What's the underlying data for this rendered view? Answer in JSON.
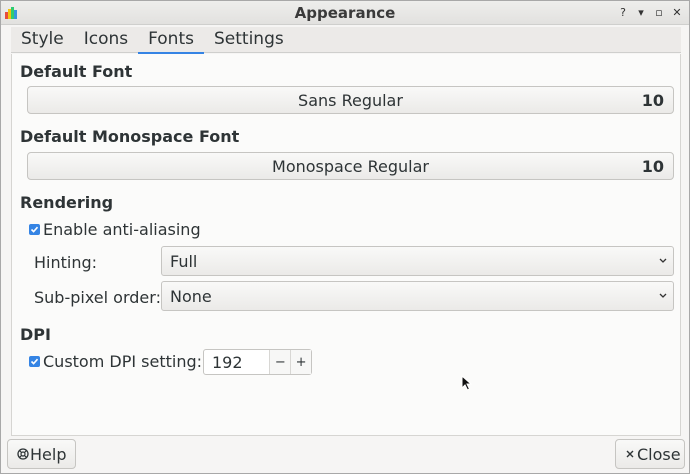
{
  "window": {
    "title": "Appearance"
  },
  "wm": {
    "help": "?",
    "minimize": "▾",
    "maximize": "▫",
    "close": "✕"
  },
  "tabs": [
    {
      "label": "Style"
    },
    {
      "label": "Icons"
    },
    {
      "label": "Fonts",
      "active": true
    },
    {
      "label": "Settings"
    }
  ],
  "default_font": {
    "title": "Default Font",
    "name": "Sans Regular",
    "size": "10"
  },
  "mono_font": {
    "title": "Default Monospace Font",
    "name": "Monospace Regular",
    "size": "10"
  },
  "rendering": {
    "title": "Rendering",
    "antialias_label": "Enable anti-aliasing",
    "antialias_checked": true,
    "hinting_label": "Hinting:",
    "hinting_value": "Full",
    "subpixel_label": "Sub-pixel order:",
    "subpixel_value": "None"
  },
  "dpi": {
    "title": "DPI",
    "custom_label": "Custom DPI setting:",
    "custom_checked": true,
    "value": "192",
    "minus": "−",
    "plus": "+"
  },
  "buttons": {
    "help": "Help",
    "close": "Close"
  },
  "colors": {
    "accent": "#3584e4"
  }
}
